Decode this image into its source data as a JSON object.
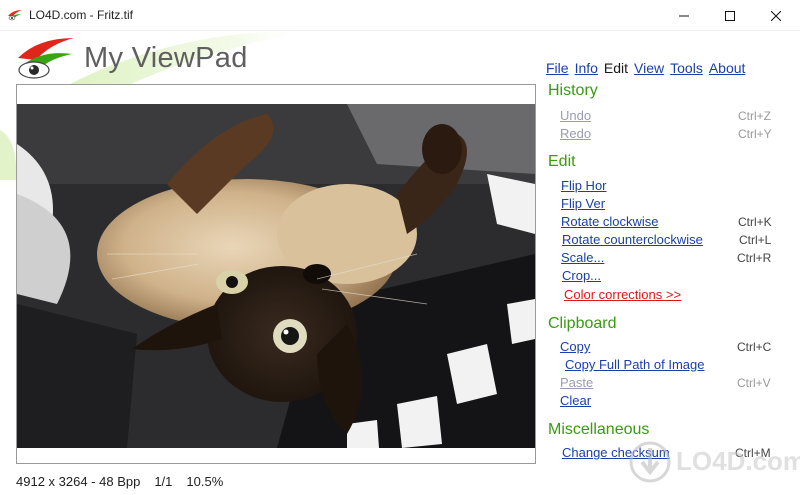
{
  "window": {
    "title": "LO4D.com - Fritz.tif"
  },
  "banner": {
    "app_name": "My ViewPad"
  },
  "menu": {
    "items": [
      {
        "label": "File"
      },
      {
        "label": "Info"
      },
      {
        "label": "Edit"
      },
      {
        "label": "View"
      },
      {
        "label": "Tools"
      },
      {
        "label": "About"
      }
    ]
  },
  "panel": {
    "history": {
      "title": "History",
      "undo": {
        "label": "Undo",
        "shortcut": "Ctrl+Z"
      },
      "redo": {
        "label": "Redo",
        "shortcut": "Ctrl+Y"
      }
    },
    "edit": {
      "title": "Edit",
      "flip_hor": {
        "label": "Flip Hor"
      },
      "flip_ver": {
        "label": "Flip Ver"
      },
      "rotate_cw": {
        "label": "Rotate clockwise",
        "shortcut": "Ctrl+K"
      },
      "rotate_ccw": {
        "label": "Rotate counterclockwise",
        "shortcut": "Ctrl+L"
      },
      "scale": {
        "label": "Scale...",
        "shortcut": "Ctrl+R"
      },
      "crop": {
        "label": "Crop..."
      },
      "color": {
        "label": "Color corrections >>"
      }
    },
    "clipboard": {
      "title": "Clipboard",
      "copy": {
        "label": "Copy",
        "shortcut": "Ctrl+C"
      },
      "copy_path": {
        "label": "Copy Full Path of Image"
      },
      "paste": {
        "label": "Paste",
        "shortcut": "Ctrl+V"
      },
      "clear": {
        "label": "Clear"
      }
    },
    "misc": {
      "title": "Miscellaneous",
      "checksum": {
        "label": "Change checksum",
        "shortcut": "Ctrl+M"
      }
    }
  },
  "status": {
    "dimensions": "4912 x 3264 - 48 Bpp",
    "page": "1/1",
    "zoom": "10.5%"
  },
  "watermark": {
    "text": "LO4D.com"
  },
  "colors": {
    "link": "#1a3fa8",
    "section": "#3a9a10",
    "accent_red": "#e0151b",
    "disabled": "#9b9bb5"
  }
}
